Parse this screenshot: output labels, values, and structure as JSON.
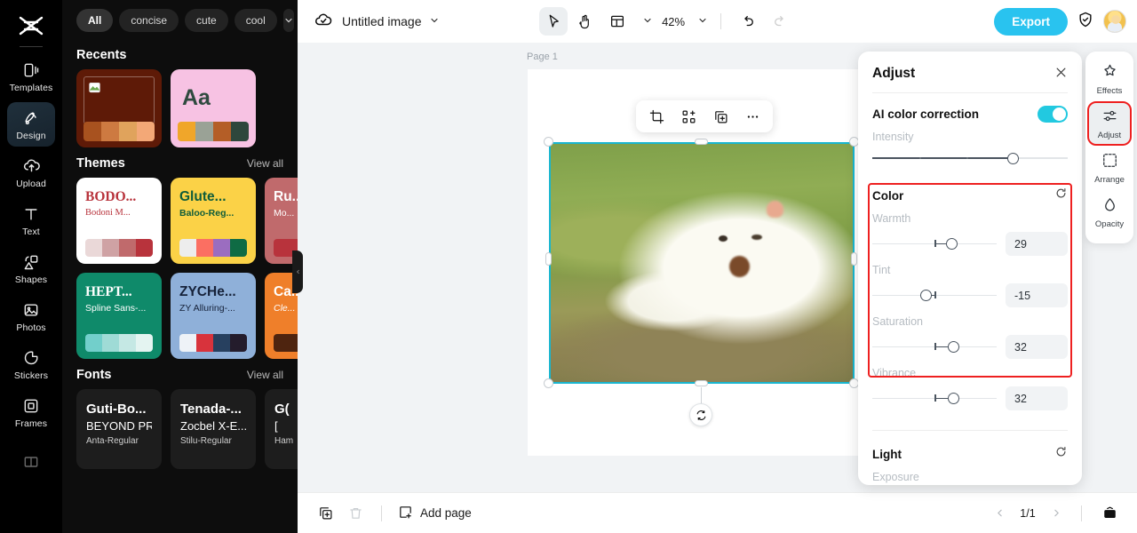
{
  "app": {
    "brand_icon": "capcut-logo-icon",
    "accent": "#29c3ef",
    "highlight_box": "#ee2020"
  },
  "rail": {
    "items": [
      {
        "label": "Templates",
        "icon": "templates-icon",
        "active": false
      },
      {
        "label": "Design",
        "icon": "design-icon",
        "active": true
      },
      {
        "label": "Upload",
        "icon": "upload-cloud-icon",
        "active": false
      },
      {
        "label": "Text",
        "icon": "text-icon",
        "active": false
      },
      {
        "label": "Shapes",
        "icon": "shapes-icon",
        "active": false
      },
      {
        "label": "Photos",
        "icon": "photos-icon",
        "active": false
      },
      {
        "label": "Stickers",
        "icon": "stickers-icon",
        "active": false
      },
      {
        "label": "Frames",
        "icon": "frames-icon",
        "active": false
      }
    ]
  },
  "panel": {
    "chips": [
      {
        "label": "All",
        "selected": true
      },
      {
        "label": "concise",
        "selected": false
      },
      {
        "label": "cute",
        "selected": false
      },
      {
        "label": "cool",
        "selected": false
      }
    ],
    "chip_more_icon": "chevron-down-icon",
    "recents": {
      "title": "Recents",
      "cards": [
        {
          "bg": "#5e1a07",
          "swatches": [
            "#a8521f",
            "#cd7a41",
            "#e0a35c",
            "#f3a877"
          ],
          "kind": "image"
        },
        {
          "bg": "#f7c2e3",
          "text": "Aa",
          "text_color": "#2f4a3f",
          "swatches": [
            "#f0a62a",
            "#9aa296",
            "#b45e27",
            "#2e473c"
          ],
          "kind": "text"
        }
      ]
    },
    "themes": {
      "title": "Themes",
      "view_all": "View all",
      "cards": [
        {
          "bg": "#ffffff",
          "t1": "BODO...",
          "t1_color": "#b8333c",
          "t2": "Bodoni M...",
          "t2_color": "#b8333c",
          "swatches": [
            "#ead8d8",
            "#cfa2a4",
            "#c06a6c",
            "#b8333c"
          ]
        },
        {
          "bg": "#fbd247",
          "t1": "Glute...",
          "t1_color": "#0f5c3a",
          "t2": "Baloo-Reg...",
          "t2_color": "#0f5c3a",
          "swatches": [
            "#ededed",
            "#fb6f62",
            "#9b6dc0",
            "#0f6b44"
          ]
        },
        {
          "bg": "#c06a6c",
          "t1": "Ru...",
          "t1_color": "#ffffff",
          "t2": "Mo...",
          "t2_color": "#ffffff",
          "swatches": [
            "#b8333c",
            "#8e2229"
          ]
        },
        {
          "bg": "#0f8a6a",
          "t1": "HEPT...",
          "t1_color": "#ffffff",
          "t2": "Spline Sans-...",
          "t2_color": "#ffffff",
          "swatches": [
            "#72cfcb",
            "#9fdbd6",
            "#c5e8e4",
            "#e4f4f1"
          ]
        },
        {
          "bg": "#8fb0d9",
          "t1": "ZYCHe...",
          "t1_color": "#16223a",
          "t2": "ZY Alluring-...",
          "t2_color": "#16223a",
          "swatches": [
            "#eef2f7",
            "#d8333c",
            "#27405f",
            "#241c2c"
          ]
        },
        {
          "bg": "#ef7f2a",
          "t1": "Ca...",
          "t1_color": "#ffffff",
          "t2": "Cle...",
          "t2_color": "#ffffff",
          "swatches": [
            "#4e240f",
            "#3a1a0b"
          ]
        }
      ]
    },
    "fonts": {
      "title": "Fonts",
      "view_all": "View all",
      "cards": [
        {
          "l1": "Guti-Bo...",
          "l2": "BEYOND PRO...",
          "l3": "Anta-Regular"
        },
        {
          "l1": "Tenada-...",
          "l2": "Zocbel X-E...",
          "l3": "Stilu-Regular"
        },
        {
          "l1": "G(",
          "l2": "[",
          "l3": "Ham"
        }
      ]
    },
    "next_icon": "chevron-right-icon",
    "collapse_icon": "chevron-left-icon"
  },
  "topbar": {
    "cloud_icon": "cloud-saved-icon",
    "doc_title": "Untitled image",
    "title_caret_icon": "chevron-down-icon",
    "tools": [
      {
        "name": "select-tool",
        "icon": "cursor-arrow-icon",
        "active": true
      },
      {
        "name": "hand-tool",
        "icon": "hand-icon",
        "active": false
      },
      {
        "name": "layout-tool",
        "icon": "layout-icon",
        "active": false
      }
    ],
    "layout_caret_icon": "chevron-down-icon",
    "zoom": "42%",
    "zoom_caret_icon": "chevron-down-icon",
    "undo_icon": "undo-icon",
    "redo_icon": "redo-icon",
    "export_label": "Export",
    "shield_icon": "shield-check-icon",
    "avatar_icon": "user-avatar"
  },
  "canvas": {
    "page_label": "Page 1",
    "image_alt": "white samoyed puppy lying on grass",
    "float_toolbar": [
      {
        "name": "crop-button",
        "icon": "crop-icon"
      },
      {
        "name": "remove-bg-button",
        "icon": "cutout-icon"
      },
      {
        "name": "duplicate-button",
        "icon": "duplicate-icon"
      },
      {
        "name": "more-button",
        "icon": "ellipsis-icon"
      }
    ],
    "rotate_icon": "rotate-icon",
    "selection_color": "#19b6cf"
  },
  "bottombar": {
    "duplicate_icon": "duplicate-icon",
    "delete_icon": "trash-icon",
    "add_page_label": "Add page",
    "add_page_icon": "add-page-icon",
    "prev_icon": "chevron-left-icon",
    "next_icon": "chevron-right-icon",
    "page_indicator": "1/1",
    "pages_panel_icon": "pages-panel-icon"
  },
  "adjust_panel": {
    "title": "Adjust",
    "close_icon": "close-icon",
    "ai": {
      "label": "AI color correction",
      "toggle_on": true,
      "intensity_label": "Intensity",
      "intensity_percent": 72
    },
    "color": {
      "title": "Color",
      "reset_icon": "reset-icon",
      "highlighted": true,
      "sliders": [
        {
          "label": "Warmth",
          "value": "29",
          "percent": 64,
          "origin_percent": 50
        },
        {
          "label": "Tint",
          "value": "-15",
          "percent": 43,
          "origin_percent": 50
        },
        {
          "label": "Saturation",
          "value": "32",
          "percent": 65,
          "origin_percent": 50
        },
        {
          "label": "Vibrance",
          "value": "32",
          "percent": 65,
          "origin_percent": 50
        }
      ]
    },
    "light": {
      "title": "Light",
      "reset_icon": "reset-icon",
      "first_label": "Exposure"
    }
  },
  "right_rail": {
    "items": [
      {
        "label": "Effects",
        "icon": "effects-icon",
        "selected": false
      },
      {
        "label": "Adjust",
        "icon": "adjust-icon",
        "selected": true
      },
      {
        "label": "Arrange",
        "icon": "arrange-icon",
        "selected": false
      },
      {
        "label": "Opacity",
        "icon": "opacity-icon",
        "selected": false
      }
    ]
  }
}
